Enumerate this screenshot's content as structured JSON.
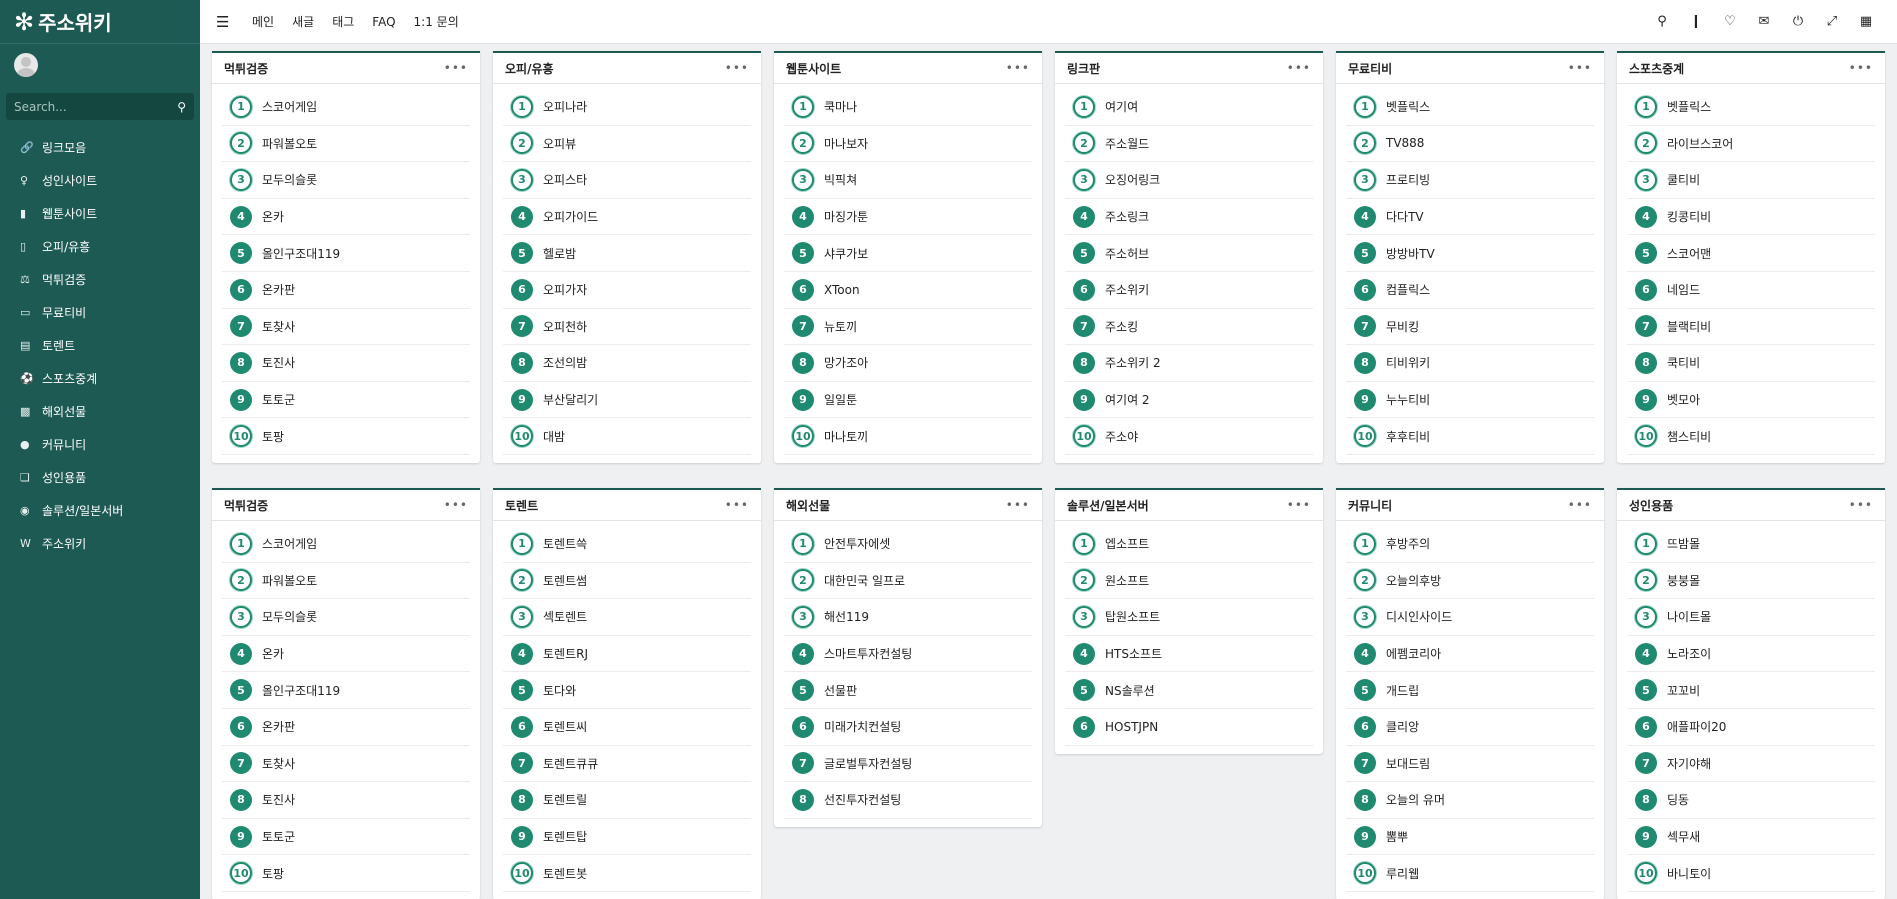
{
  "sidebar": {
    "logo": "주소위키",
    "search_placeholder": "Search...",
    "items": [
      {
        "label": "링크모음",
        "icon": "link-icon"
      },
      {
        "label": "성인사이트",
        "icon": "venus-icon"
      },
      {
        "label": "웹툰사이트",
        "icon": "book-icon"
      },
      {
        "label": "오피/유흥",
        "icon": "mobile-icon"
      },
      {
        "label": "먹튀검증",
        "icon": "scale-icon"
      },
      {
        "label": "무료티비",
        "icon": "tv-icon"
      },
      {
        "label": "토렌트",
        "icon": "file-icon"
      },
      {
        "label": "스포츠중계",
        "icon": "soccer-icon"
      },
      {
        "label": "해외선물",
        "icon": "chart-icon"
      },
      {
        "label": "커뮤니티",
        "icon": "users-icon"
      },
      {
        "label": "성인용품",
        "icon": "cart-icon"
      },
      {
        "label": "솔루션/일본서버",
        "icon": "apple-icon"
      },
      {
        "label": "주소위키",
        "icon": "wiki-icon"
      }
    ]
  },
  "topbar": {
    "links": [
      "메인",
      "새글",
      "태그",
      "FAQ",
      "1:1 문의"
    ],
    "right_icons": [
      "search-icon",
      "bookmark-icon",
      "bell-icon",
      "mail-icon",
      "power-icon",
      "expand-icon",
      "grid-icon"
    ]
  },
  "cards": [
    {
      "title": "먹튀검증",
      "items": [
        "스코어게임",
        "파워볼오토",
        "모두의슬롯",
        "온카",
        "올인구조대119",
        "온카판",
        "토찾사",
        "토진사",
        "토토군",
        "토팡"
      ]
    },
    {
      "title": "오피/유흥",
      "items": [
        "오피나라",
        "오피뷰",
        "오피스타",
        "오피가이드",
        "헬로밤",
        "오피가자",
        "오피천하",
        "조선의밤",
        "부산달리기",
        "대밤"
      ]
    },
    {
      "title": "웹툰사이트",
      "items": [
        "쿡마나",
        "마나보자",
        "빅픽쳐",
        "마징가툰",
        "샤쿠가보",
        "XToon",
        "뉴토끼",
        "망가조아",
        "일일툰",
        "마나토끼"
      ]
    },
    {
      "title": "링크판",
      "items": [
        "여기여",
        "주소월드",
        "오징어링크",
        "주소링크",
        "주소허브",
        "주소위키",
        "주소킹",
        "주소위키 2",
        "여기여 2",
        "주소야"
      ]
    },
    {
      "title": "무료티비",
      "items": [
        "벳플릭스",
        "TV888",
        "프로티빙",
        "다다TV",
        "방방바TV",
        "컴플릭스",
        "무비킹",
        "티비위키",
        "누누티비",
        "후후티비"
      ]
    },
    {
      "title": "스포츠중계",
      "items": [
        "벳플릭스",
        "라이브스코어",
        "쿨티비",
        "킹콩티비",
        "스코어맨",
        "네임드",
        "블랙티비",
        "쿡티비",
        "벳모아",
        "챔스티비"
      ]
    },
    {
      "title": "먹튀검증",
      "items": [
        "스코어게임",
        "파워볼오토",
        "모두의슬롯",
        "온카",
        "올인구조대119",
        "온카판",
        "토찾사",
        "토진사",
        "토토군",
        "토팡"
      ]
    },
    {
      "title": "토렌트",
      "items": [
        "토렌트쓱",
        "토렌트썸",
        "섹토렌트",
        "토렌트RJ",
        "토다와",
        "토렌트씨",
        "토렌트큐큐",
        "토렌트릴",
        "토렌트탑",
        "토렌트봇"
      ]
    },
    {
      "title": "해외선물",
      "items": [
        "안전투자에셋",
        "대한민국 일프로",
        "해선119",
        "스마트투자컨설팅",
        "선물판",
        "미래가치컨설팅",
        "글로벌투자컨설팅",
        "선진투자컨설팅"
      ]
    },
    {
      "title": "솔루션/일본서버",
      "items": [
        "엡소프트",
        "원소프트",
        "탑원소프트",
        "HTS소프트",
        "NS솔루션",
        "HOSTJPN"
      ]
    },
    {
      "title": "커뮤니티",
      "items": [
        "후방주의",
        "오늘의후방",
        "디시인사이드",
        "에펨코리아",
        "개드립",
        "클리앙",
        "보대드림",
        "오늘의 유머",
        "뽐뿌",
        "루리웹"
      ]
    },
    {
      "title": "성인용품",
      "items": [
        "뜨밤몰",
        "붕붕몰",
        "나이트몰",
        "노라조이",
        "꼬꼬비",
        "애플파이20",
        "자기야해",
        "딩동",
        "섹무새",
        "바니토이"
      ]
    }
  ],
  "more_label": "•••",
  "colors": {
    "sidebar": "#1e5a54",
    "accent": "#1f8a6f",
    "background": "#eef0f2"
  }
}
